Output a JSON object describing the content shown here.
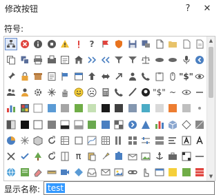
{
  "dialog": {
    "title": "修改按钮",
    "help_label": "?",
    "close_label": "✕"
  },
  "symbols": {
    "label": "符号:",
    "rows": [
      [
        "org-chart-icon",
        "cancel-circle-icon",
        "info-circle-icon",
        "stop-octagon-icon",
        "warning-triangle-icon",
        "exclamation-icon",
        "question-mark-icon",
        "priority-flag-icon",
        "shield-icon",
        "floppy-disk-icon",
        "save-cloud-icon",
        "new-page-icon",
        "folder-open-icon",
        "blank-document-icon",
        "document-icon"
      ],
      [
        "copy-files-icon",
        "save-all-icon",
        "printer-icon",
        "fax-icon",
        "form-icon",
        "home-icon",
        "arrows-in-icon",
        "arrows-out-icon",
        "filter-icon",
        "funnel-icon",
        "balance-scale-icon",
        "shapes-icon",
        "tools-icon",
        "microphone-icon",
        "back-arrow-circle-icon"
      ],
      [
        "pushpin-icon",
        "lock-icon",
        "box-icon",
        "notes-icon",
        "flag-icon",
        "calendar-grid-icon",
        "up-arrow-icon",
        "left-right-arrow-icon",
        "diagonal-arrow-icon",
        "users-icon",
        "phone-icon",
        "clipboard-icon",
        "mouse-icon",
        "quote-icon",
        "eye-icon"
      ],
      [
        "people-icon",
        "person-icon",
        "gear-plate-icon",
        "snowflake-icon",
        "hand-icon",
        "smiley-icon",
        "sad-face-icon",
        "calculator-icon",
        "handset-icon",
        "paint-brush-icon",
        "eight-ball-icon",
        "dollar-glyph-icon",
        "tilde-glyph-icon",
        "eye-outline-icon",
        "minus-glyph-icon"
      ],
      [
        "chart-columns-icon",
        "color-swatch-icon",
        "white-square-icon",
        "blue-square-icon",
        "grey-square-icon",
        "green-square-icon",
        "light-green-square-icon",
        "black-square-icon",
        "dark-square-icon",
        "blue-grey-square-icon",
        "teal-square-icon",
        "light-square-icon",
        "orange-square-icon",
        "grey-box-icon",
        "grey-dot-icon"
      ],
      [
        "page-gradient-icon",
        "black-block-icon",
        "white-block-icon",
        "grey-block-icon",
        "black-rule-icon",
        "grey-rule-icon",
        "green-block-icon",
        "blue-block-icon",
        "checker-icon",
        "arrow-right-circle-icon",
        "pyramid-icon",
        "bar-chart-icon",
        "three-d-box-icon",
        "white-diamond-icon",
        "shaded-block-icon"
      ],
      [
        "pie-chart-icon",
        "star-rays-icon",
        "cube-icon",
        "rotate-icon",
        "chart-table-icon",
        "square-outline-icon",
        "curve-chart-icon",
        "table-grid-icon",
        "vertical-bars-icon",
        "thumbnails-icon",
        "sliders-icon",
        "stacked-boxes-icon",
        "horizontal-bars-icon",
        "letter-a-icon",
        "letter-a-outline-icon"
      ],
      [
        "close-x-icon",
        "check-mark-icon",
        "tree-icon",
        "refresh-icon",
        "column-icon",
        "pi-glyph-icon",
        "paste-icon",
        "highlighter-icon",
        "puzzle-icon",
        "envelope-open-icon",
        "photo-icon",
        "anchor-icon",
        "briefcase-icon",
        "crossword-icon",
        "line-icon"
      ],
      [
        "globe-icon",
        "sticky-note-icon",
        "eraser-icon",
        "ruler-icon",
        "video-clip-icon",
        "diamond-blue-icon",
        "inbox-icon",
        "mail-icon",
        "image-frame-icon",
        "chain-link-icon",
        "cursor-hand-icon",
        "window-icon",
        "yellow-note-icon",
        "green-note-icon",
        "stripe-icon"
      ]
    ]
  },
  "display": {
    "label": "显示名称:",
    "value": "test"
  }
}
